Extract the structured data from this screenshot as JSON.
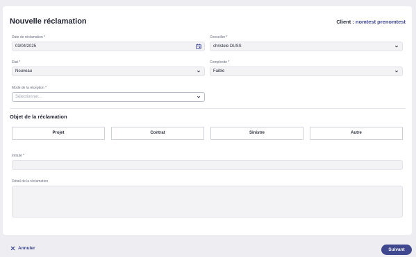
{
  "header": {
    "title": "Nouvelle réclamation",
    "client_label": "Client :",
    "client_value": "nomtest prenomtest"
  },
  "form": {
    "date": {
      "label": "Date de réclamation *",
      "value": "03/04/2025",
      "icon": "calendar-icon"
    },
    "conseiller": {
      "label": "Conseiller *",
      "value": "christele DUSS"
    },
    "etat": {
      "label": "Etat *",
      "value": "Nouveau"
    },
    "complexite": {
      "label": "Complexite *",
      "value": "Faible"
    },
    "mode_reception": {
      "label": "Mode de la réception *",
      "placeholder": "Sélectionner..."
    }
  },
  "objet": {
    "title": "Objet de la réclamation",
    "options": [
      "Projet",
      "Contrat",
      "Sinistre",
      "Autre"
    ]
  },
  "intitule": {
    "label": "Intitulé *",
    "value": ""
  },
  "detail": {
    "label": "Détail de la réclamation",
    "value": ""
  },
  "footer": {
    "cancel_label": "Annuler",
    "submit_label": "Suivant"
  },
  "colors": {
    "accent": "#3f488f",
    "link": "#3c4591",
    "page_bg": "#eeeef2",
    "field_bg": "#f3f3f5"
  }
}
